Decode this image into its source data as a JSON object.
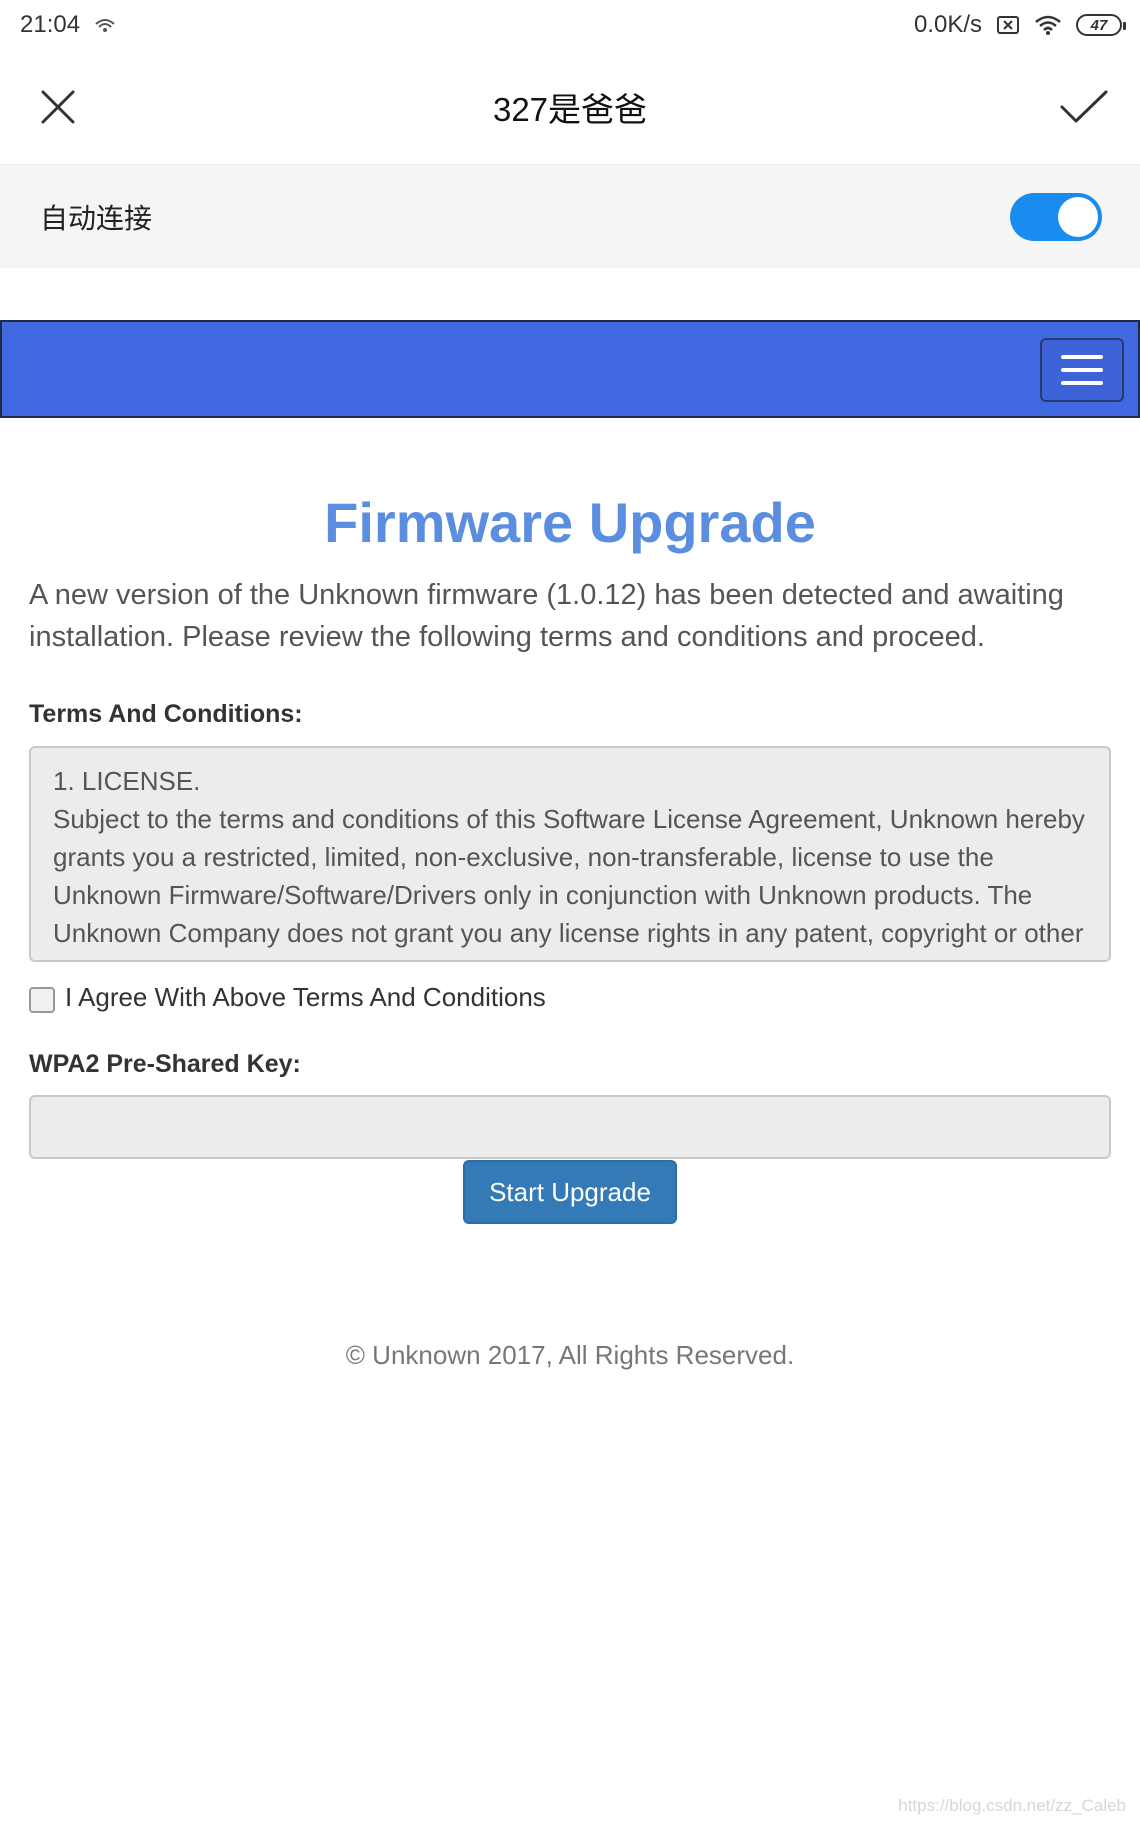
{
  "status_bar": {
    "time": "21:04",
    "network_speed": "0.0K/s",
    "battery": "47"
  },
  "header": {
    "title": "327是爸爸",
    "close_icon": "close-icon",
    "confirm_icon": "check-icon"
  },
  "auto_connect": {
    "label": "自动连接",
    "enabled": true
  },
  "web": {
    "navbar_color": "#4169e1",
    "title": "Firmware Upgrade",
    "intro": "A new version of the Unknown firmware (1.0.12) has been detected and awaiting installation. Please review the following terms and conditions and proceed.",
    "terms_label": "Terms And Conditions:",
    "terms_text_1": "1. LICENSE.",
    "terms_text_2": "Subject to the terms and conditions of this Software License Agreement, Unknown hereby grants you a restricted, limited, non-exclusive, non-transferable, license to use the Unknown Firmware/Software/Drivers only in conjunction with Unknown products. The Unknown Company does not grant you any license rights in any patent, copyright or other intellectual property rights owned by or licensed...",
    "agree_label": "I Agree With Above Terms And Conditions",
    "agree_checked": false,
    "psk_label": "WPA2 Pre-Shared Key:",
    "psk_value": "",
    "start_button": "Start Upgrade",
    "footer": "© Unknown 2017, All Rights Reserved."
  },
  "watermark": "https://blog.csdn.net/zz_Caleb",
  "colors": {
    "accent_toggle": "#1a8cf0",
    "title_blue": "#5b8ee0",
    "button_blue": "#337ab7"
  }
}
